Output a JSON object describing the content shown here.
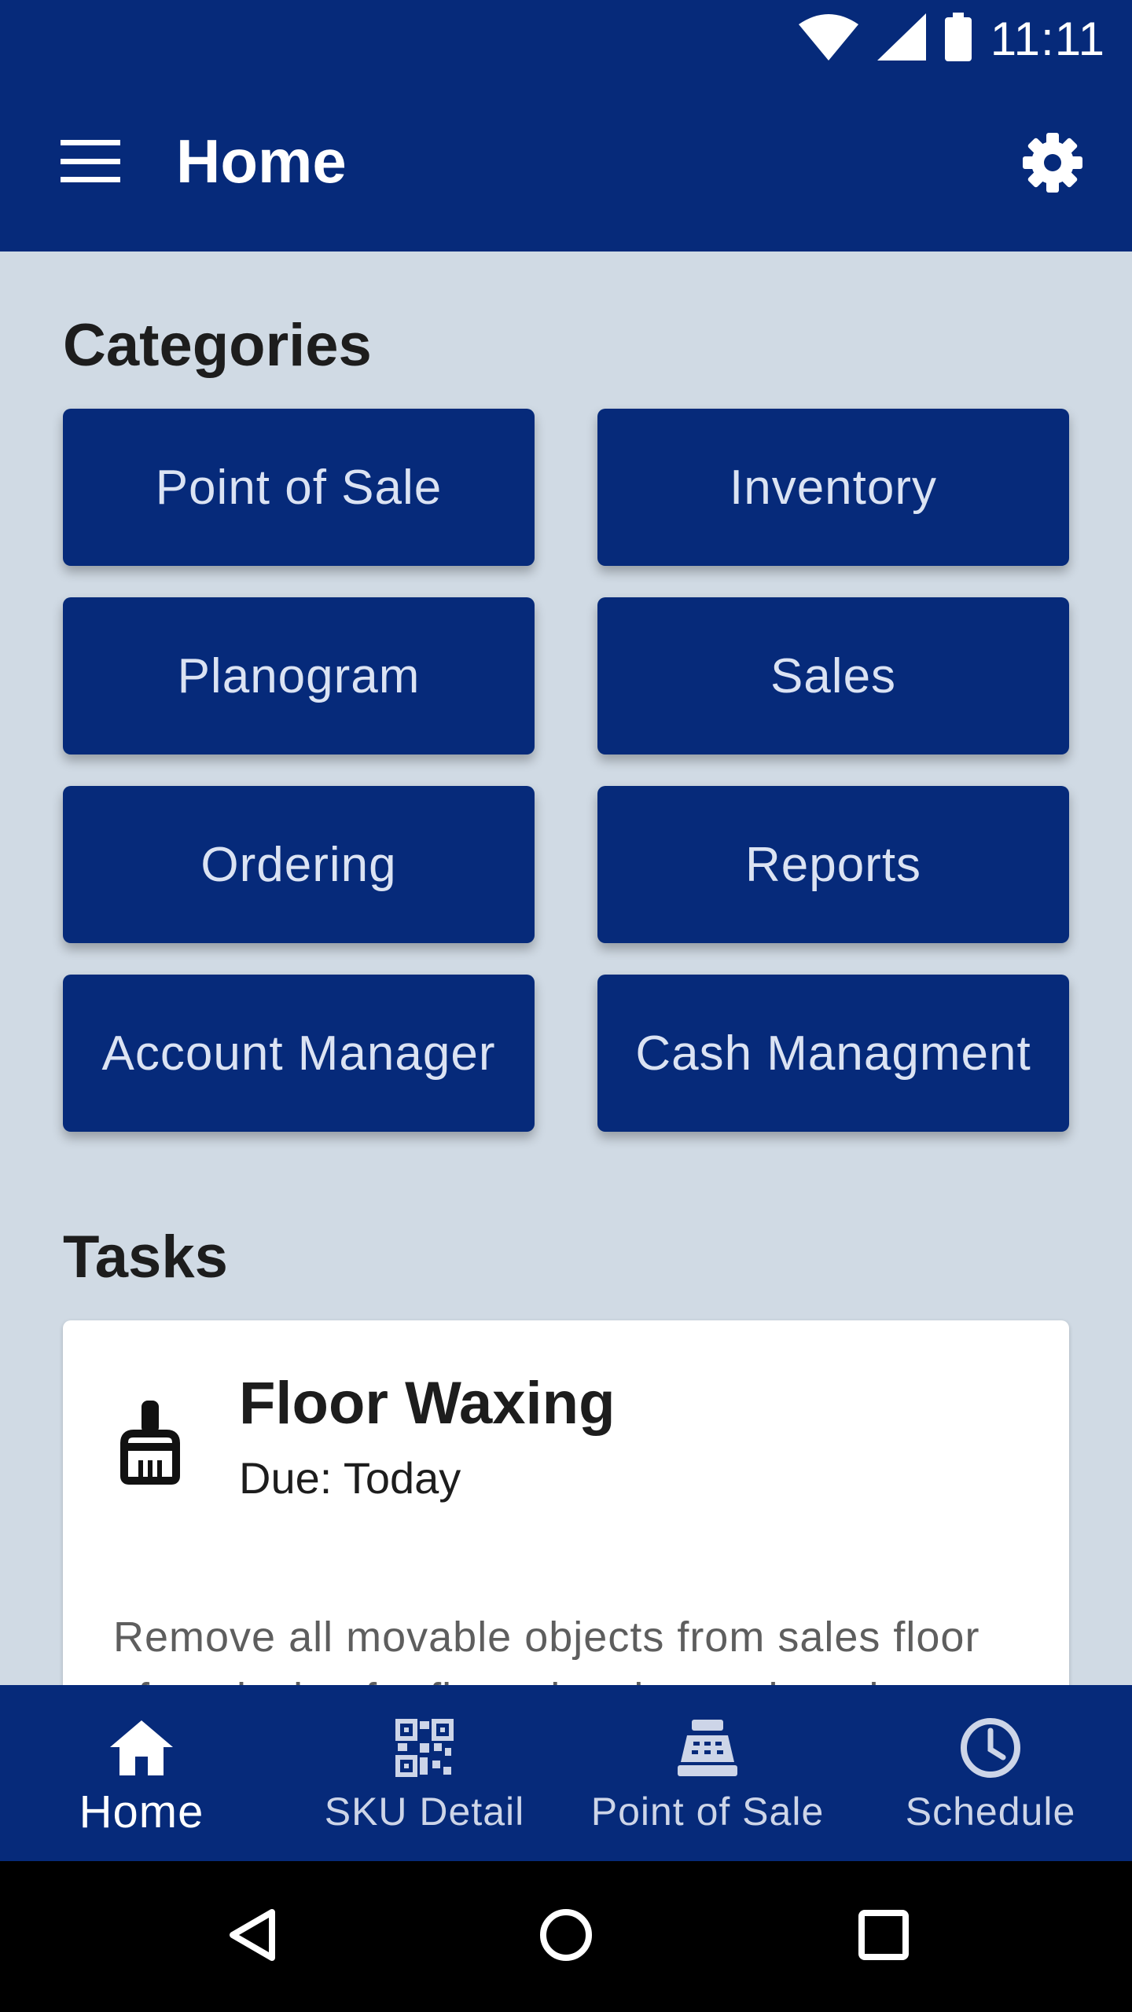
{
  "status_bar": {
    "time": "11:11"
  },
  "app_bar": {
    "title": "Home"
  },
  "categories": {
    "title": "Categories",
    "items": [
      {
        "label": "Point of Sale"
      },
      {
        "label": "Inventory"
      },
      {
        "label": "Planogram"
      },
      {
        "label": "Sales"
      },
      {
        "label": "Ordering"
      },
      {
        "label": "Reports"
      },
      {
        "label": "Account Manager"
      },
      {
        "label": "Cash Managment"
      }
    ]
  },
  "tasks": {
    "title": "Tasks",
    "items": [
      {
        "icon": "broom-icon",
        "title": "Floor Waxing",
        "due": "Due: Today",
        "description": "Remove all movable objects from sales floor after closing for floor cleaning and waxing."
      }
    ]
  },
  "bottom_nav": {
    "items": [
      {
        "label": "Home",
        "icon": "home-icon",
        "active": true
      },
      {
        "label": "SKU Detail",
        "icon": "qr-code-icon",
        "active": false
      },
      {
        "label": "Point of Sale",
        "icon": "cash-register-icon",
        "active": false
      },
      {
        "label": "Schedule",
        "icon": "clock-icon",
        "active": false
      }
    ]
  },
  "colors": {
    "primary": "#062a7a",
    "background": "#d0dae4",
    "card": "#ffffff",
    "category_text": "#dbe3f3"
  }
}
